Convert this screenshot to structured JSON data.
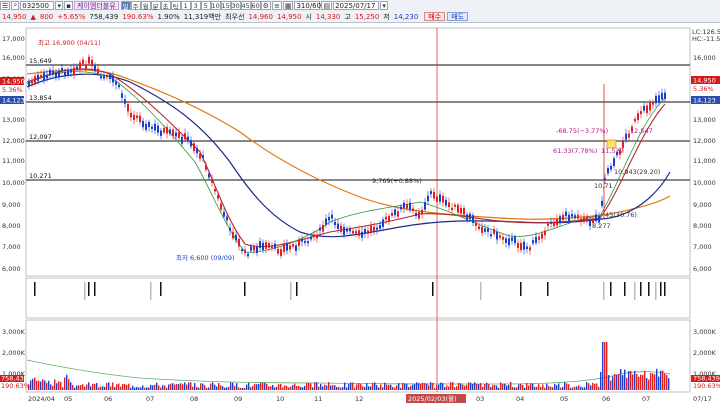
{
  "toolbar": {
    "code": "032500",
    "name": "케이엠더블유",
    "period_buttons": [
      "주",
      "월",
      "분",
      "초",
      "틱",
      "1",
      "3",
      "5",
      "10",
      "15",
      "30",
      "45",
      "60"
    ],
    "active_period": "일",
    "first_button": "일",
    "page_count": "310/600",
    "date": "2025/07/17",
    "price": "14,950",
    "change_arrow": "▲",
    "change": "800",
    "change_pct": "+5.65%",
    "volume": "758,439",
    "volume_ratio": "190.63%",
    "turnover_rate": "1.90%",
    "amount": "11,319백만",
    "order_label": "최우선",
    "open_label": "시",
    "open": "14,960",
    "ask": "14,950",
    "high_label": "고",
    "high": "14,330",
    "high_val": "15,250",
    "low_label": "저",
    "low": "14,230",
    "buy_label": "매수",
    "sell_label": "매도"
  },
  "legend_right": {
    "lc": "LC:126.5",
    "hc": "HC:-11.5"
  },
  "price_labels": {
    "current": "14,950",
    "current_pct": "5.36%",
    "left_current": "14,950",
    "left_pct": "5.36%",
    "left_sub": "14,123",
    "right_sub": "14,123"
  },
  "chart_data": {
    "type": "candlestick",
    "y_axis": [
      "17,000",
      "16,000",
      "15,000",
      "14,000",
      "13,000",
      "12,000",
      "11,000",
      "10,000",
      "9,000",
      "8,000",
      "7,000",
      "6,000"
    ],
    "x_axis": [
      "2024/04",
      "05",
      "06",
      "07",
      "08",
      "09",
      "10",
      "11",
      "12",
      "2025/02/03(월)",
      "03",
      "04",
      "05",
      "06",
      "07",
      "07/17"
    ],
    "hlines": [
      "15,649",
      "13,854",
      "12,097",
      "10,271"
    ],
    "annotations": {
      "high": "최고 16,900 (04/11)",
      "low": "최저 6,600 (09/09)",
      "mid": "9,769(+0.88%)",
      "up1": "-68.75(−3.77%)",
      "up1b": "12,547",
      "up2": "61.33(7.78%)",
      "up2b": "11,527",
      "p1": "10,943(29.20)",
      "p2": "45(30.76)",
      "p3": "8,277",
      "p4": "10,71"
    },
    "volume_axis": [
      "3,000K",
      "2,000K",
      "1,000K"
    ],
    "volume_labels": {
      "left": "758,439",
      "left_pct": "190.63%",
      "right": "758,439",
      "right_pct": "190.63%"
    }
  }
}
